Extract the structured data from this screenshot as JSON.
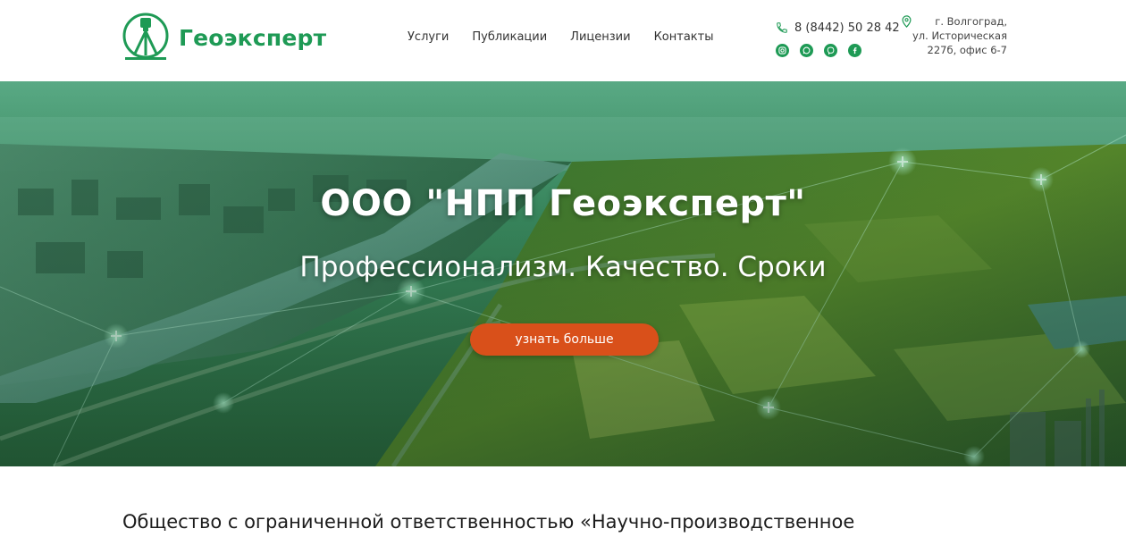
{
  "header": {
    "logo_text": "Геоэксперт",
    "nav": [
      {
        "label": "Услуги"
      },
      {
        "label": "Публикации"
      },
      {
        "label": "Лицензии"
      },
      {
        "label": "Контакты"
      }
    ],
    "phone": "8 (8442) 50 28 42",
    "address_lines": [
      "г. Волгоград,",
      "ул. Историческая",
      "227б, офис 6-7"
    ],
    "socials": [
      "instagram-icon",
      "whatsapp-icon",
      "viber-icon",
      "facebook-icon"
    ]
  },
  "hero": {
    "title": "ООО \"НПП Геоэксперт\"",
    "subtitle": "Профессионализм. Качество. Сроки",
    "button_label": "узнать больше"
  },
  "intro": {
    "text": "Общество с ограниченной ответственностью «Научно-производственное"
  },
  "colors": {
    "brand_green": "#1e9a55",
    "accent_orange": "#d9501a",
    "text_dark": "#333333"
  }
}
